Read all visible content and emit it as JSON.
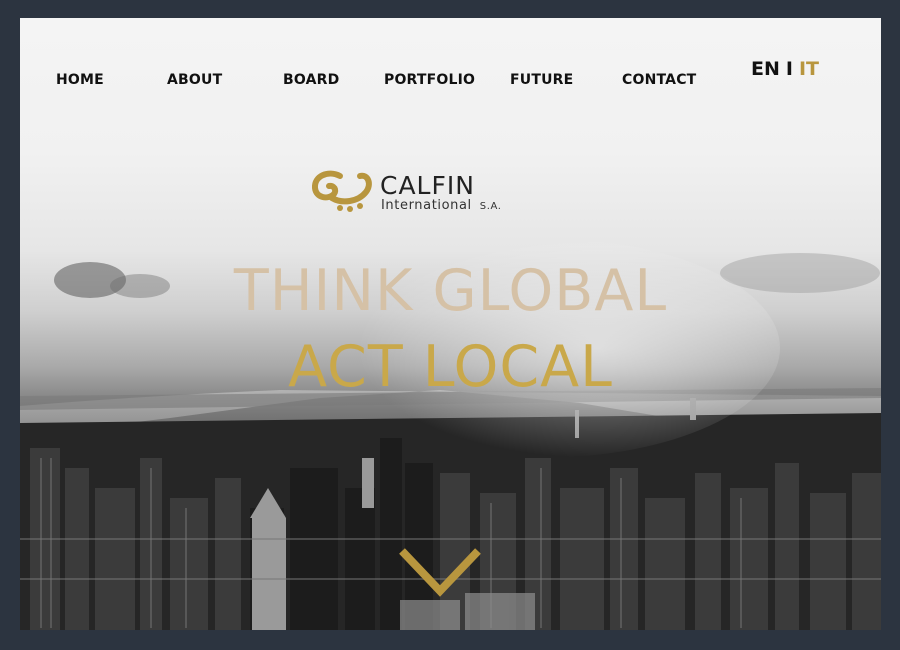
{
  "nav": {
    "items": [
      {
        "label": "HOME"
      },
      {
        "label": "ABOUT"
      },
      {
        "label": "BOARD"
      },
      {
        "label": "PORTFOLIO"
      },
      {
        "label": "FUTURE"
      },
      {
        "label": "CONTACT"
      }
    ]
  },
  "lang": {
    "en": "EN",
    "separator": "I",
    "it": "IT"
  },
  "logo": {
    "name": "CALFIN",
    "sub": "International",
    "suffix": "S.A."
  },
  "hero": {
    "line1": "THINK GLOBAL",
    "line2": "ACT LOCAL"
  },
  "icons": {
    "scroll_down": "chevron-down-icon",
    "logo_mark": "calfin-logo-mark-icon"
  },
  "colors": {
    "accent": "#c9a84a",
    "accent_light": "#d5c1a6",
    "nav_text": "#111111",
    "page_bg": "#2c3440"
  }
}
